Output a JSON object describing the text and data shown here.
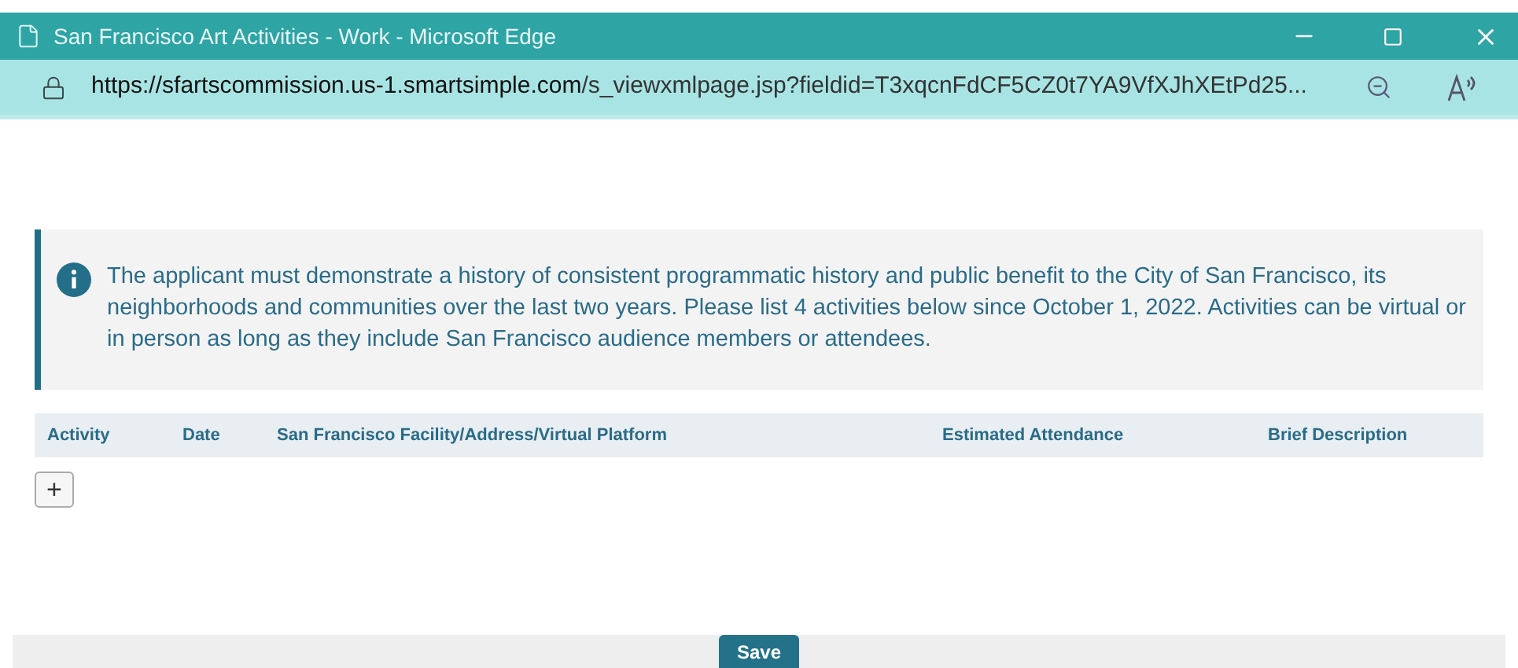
{
  "window": {
    "title": "San Francisco Art Activities - Work - Microsoft Edge"
  },
  "address_bar": {
    "url_host": "https://sfartscommission.us-1.smartsimple.com",
    "url_path": "/s_viewxmlpage.jsp?fieldid=T3xqcnFdCF5CZ0t7YA9VfXJhXEtPd25..."
  },
  "notice": "The applicant must demonstrate a history of consistent programmatic history and public benefit to the City of San Francisco, its neighborhoods and communities over the last two years. Please list 4 activities below since October 1, 2022. Activities can be virtual or in person as long as they include San Francisco audience members or attendees.",
  "table": {
    "columns": [
      "Activity",
      "Date",
      "San Francisco Facility/Address/Virtual Platform",
      "Estimated Attendance",
      "Brief Description"
    ]
  },
  "add_button": "+",
  "footer": {
    "save_button": "Save"
  }
}
